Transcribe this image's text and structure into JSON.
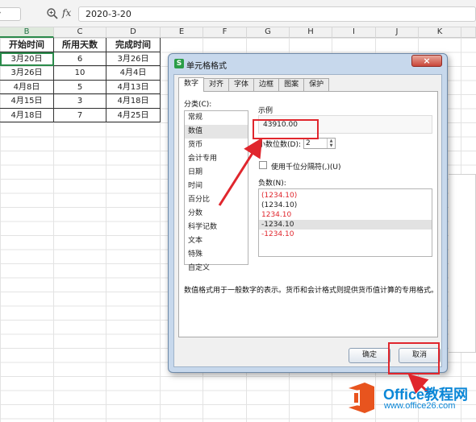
{
  "formula_bar": {
    "fx": "fx",
    "value": "2020-3-20"
  },
  "columns": [
    "B",
    "C",
    "D",
    "E",
    "F",
    "G",
    "H",
    "I",
    "J",
    "K"
  ],
  "table": {
    "headers": [
      "开始时间",
      "所用天数",
      "完成时间"
    ],
    "rows": [
      [
        "3月20日",
        "6",
        "3月26日"
      ],
      [
        "3月26日",
        "10",
        "4月4日"
      ],
      [
        "4月8日",
        "5",
        "4月13日"
      ],
      [
        "4月15日",
        "3",
        "4月18日"
      ],
      [
        "4月18日",
        "7",
        "4月25日"
      ]
    ]
  },
  "dialog": {
    "title": "单元格格式",
    "close": "×",
    "tabs": [
      "数字",
      "对齐",
      "字体",
      "边框",
      "图案",
      "保护"
    ],
    "category_label": "分类(C):",
    "categories": [
      "常规",
      "数值",
      "货币",
      "会计专用",
      "日期",
      "时间",
      "百分比",
      "分数",
      "科学记数",
      "文本",
      "特殊",
      "自定义"
    ],
    "selected_category": "数值",
    "sample_label": "示例",
    "sample_value": "43910.00",
    "decimal_label": "小数位数(D):",
    "decimal_value": "2",
    "thousands_label": "使用千位分隔符(,)(U)",
    "negative_label": "负数(N):",
    "negatives": [
      {
        "text": "(1234.10)",
        "color": "#e0262d"
      },
      {
        "text": "(1234.10)",
        "color": "#222222"
      },
      {
        "text": "1234.10",
        "color": "#e0262d"
      },
      {
        "text": "-1234.10",
        "color": "#222222"
      },
      {
        "text": "-1234.10",
        "color": "#e0262d"
      }
    ],
    "description": "数值格式用于一般数字的表示。货币和会计格式则提供货币值计算的专用格式。",
    "ok_label": "确定",
    "cancel_label": "取消"
  },
  "watermark": {
    "title": "Office教程网",
    "url": "www.office26.com"
  },
  "colors": {
    "accent_green": "#2a8a4a",
    "annotation_red": "#e0262d",
    "dialog_frame": "#c7d8ec",
    "watermark_blue": "#0b87d7",
    "logo_orange": "#e8541e"
  }
}
